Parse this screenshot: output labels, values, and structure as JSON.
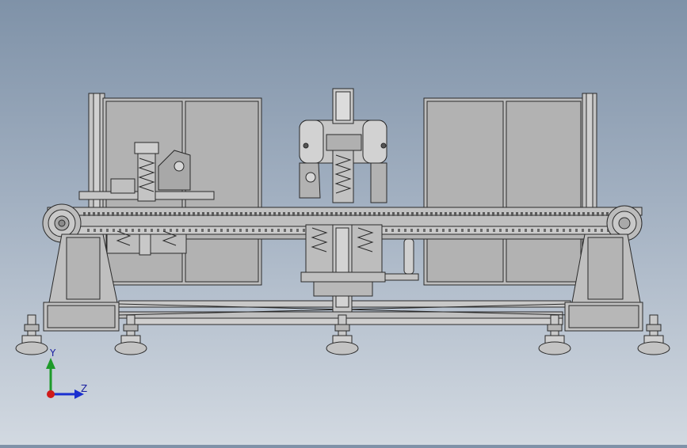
{
  "viewport": {
    "background_top": "#7f92a8",
    "background_bottom": "#d2d9e1",
    "model_fill": "#b8b8b8",
    "model_edge": "#2a2a2a"
  },
  "triad": {
    "y_label": "Y",
    "z_label": "Z",
    "y_color": "#1e9a2a",
    "z_color": "#1a2fd0",
    "x_color": "#d01a1a"
  }
}
